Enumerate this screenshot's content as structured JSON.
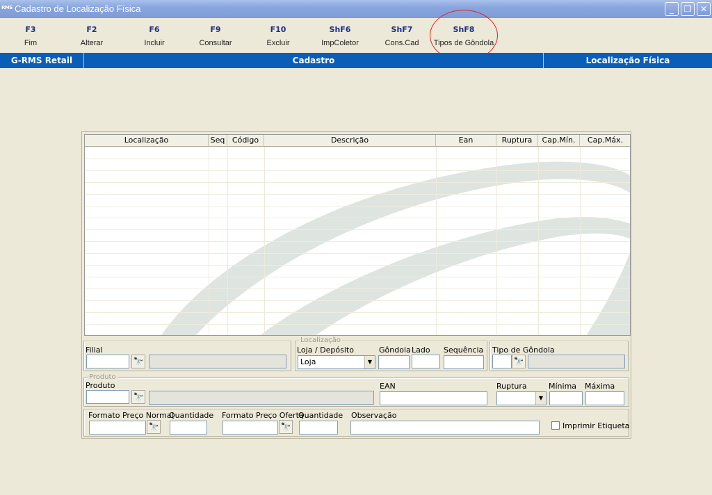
{
  "window": {
    "app_icon_text": "RMS",
    "title": "Cadastro de Localização Física",
    "minimize": "_",
    "restore": "❐",
    "close": "✕"
  },
  "toolbar": {
    "buttons": [
      {
        "key": "F3",
        "label": "Fim"
      },
      {
        "key": "F2",
        "label": "Alterar"
      },
      {
        "key": "F6",
        "label": "Incluir"
      },
      {
        "key": "F9",
        "label": "Consultar"
      },
      {
        "key": "F10",
        "label": "Excluir"
      },
      {
        "key": "ShF6",
        "label": "ImpColetor"
      },
      {
        "key": "ShF7",
        "label": "Cons.Cad"
      },
      {
        "key": "ShF8",
        "label": "Tipos de Gôndola"
      }
    ]
  },
  "header": {
    "left": "G-RMS Retail",
    "center": "Cadastro",
    "right": "Localização Física"
  },
  "grid": {
    "columns": [
      "Localização",
      "Seq",
      "Código",
      "Descrição",
      "Ean",
      "Ruptura",
      "Cap.Mín.",
      "Cap.Máx."
    ]
  },
  "form": {
    "filial_label": "Filial",
    "localizacao_legend": "Localização",
    "loja_deposito_label": "Loja / Depósito",
    "loja_deposito_value": "Loja",
    "gondola_label": "Gôndola",
    "lado_label": "Lado",
    "sequencia_label": "Sequência",
    "tipo_gondola_label": "Tipo de Gôndola",
    "produto_legend": "Produto",
    "produto_label": "Produto",
    "ean_label": "EAN",
    "ruptura_label": "Ruptura",
    "minima_label": "Mínima",
    "maxima_label": "Máxima",
    "formato_normal_label": "Formato Preço Normal",
    "quantidade_label_1": "Quantidade",
    "formato_oferta_label": "Formato Preço Oferta",
    "quantidade_label_2": "Quantidade",
    "observacao_label": "Observação",
    "imprimir_label": "Imprimir Etiqueta",
    "binoculars_icon": "🔭"
  }
}
